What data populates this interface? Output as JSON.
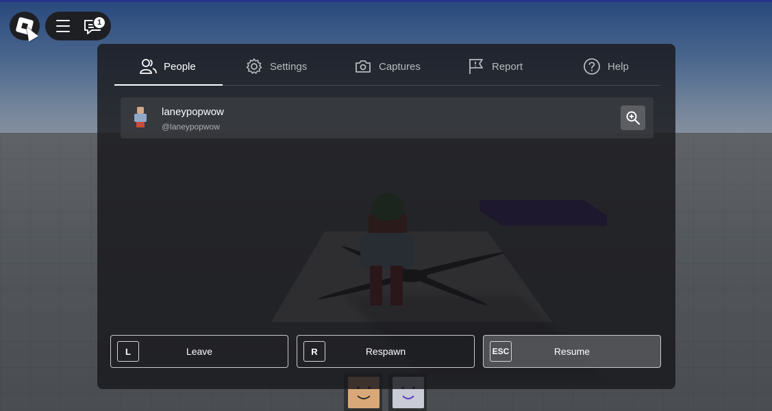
{
  "menu": {
    "tabs": [
      {
        "label": "People",
        "icon": "people-icon",
        "active": true
      },
      {
        "label": "Settings",
        "icon": "gear-icon",
        "active": false
      },
      {
        "label": "Captures",
        "icon": "camera-icon",
        "active": false
      },
      {
        "label": "Report",
        "icon": "flag-icon",
        "active": false
      },
      {
        "label": "Help",
        "icon": "help-icon",
        "active": false
      }
    ]
  },
  "topbar": {
    "notification_count": "1"
  },
  "people": {
    "players": [
      {
        "display_name": "laneypopwow",
        "username": "@laneypopwow"
      }
    ]
  },
  "actions": [
    {
      "key": "L",
      "label": "Leave"
    },
    {
      "key": "R",
      "label": "Respawn"
    },
    {
      "key": "ESC",
      "label": "Resume"
    }
  ],
  "colors": {
    "panel_bg": "#18191c",
    "accent": "#ffffff",
    "purple_block": "#4b23b8"
  }
}
